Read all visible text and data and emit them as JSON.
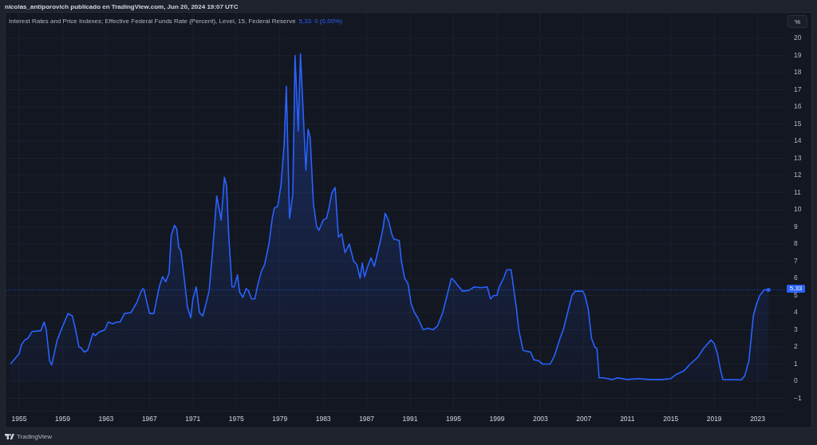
{
  "header": {
    "publication": "nicolas_antiporovich publicado en TradingView.com, Jun 20, 2024 19:07 UTC"
  },
  "chart": {
    "legend": {
      "title": "Interest Rates and Price Indexes; Effective Federal Funds Rate (Percent), Level, 15, Federal Reserve",
      "value": "5,33",
      "change": "0 (0,00%)"
    },
    "scale_button": "%",
    "chart_data": {
      "type": "area",
      "grid": true,
      "x": [
        1954.2,
        1954.6,
        1955.0,
        1955.2,
        1955.5,
        1955.8,
        1956.2,
        1957.0,
        1957.3,
        1957.5,
        1957.8,
        1958.0,
        1958.5,
        1959.0,
        1959.5,
        1959.9,
        1960.2,
        1960.5,
        1960.7,
        1961.0,
        1961.3,
        1961.8,
        1962.0,
        1962.3,
        1962.9,
        1963.2,
        1963.6,
        1964.0,
        1964.3,
        1964.7,
        1965.3,
        1965.8,
        1966.2,
        1966.4,
        1966.5,
        1967.0,
        1967.4,
        1967.9,
        1968.2,
        1968.5,
        1968.8,
        1969.0,
        1969.3,
        1969.5,
        1969.7,
        1969.9,
        1970.2,
        1970.5,
        1970.8,
        1971.0,
        1971.3,
        1971.6,
        1971.9,
        1972.2,
        1972.5,
        1972.8,
        1973.2,
        1973.6,
        1973.9,
        1974.1,
        1974.3,
        1974.6,
        1974.8,
        1975.1,
        1975.3,
        1975.6,
        1975.9,
        1976.1,
        1976.4,
        1976.7,
        1977.0,
        1977.3,
        1977.6,
        1978.0,
        1978.3,
        1978.5,
        1978.8,
        1979.1,
        1979.4,
        1979.6,
        1979.9,
        1980.2,
        1980.4,
        1980.7,
        1980.9,
        1981.4,
        1981.6,
        1981.8,
        1982.1,
        1982.4,
        1982.6,
        1983.0,
        1983.3,
        1983.5,
        1983.8,
        1984.1,
        1984.4,
        1984.7,
        1985.0,
        1985.4,
        1985.8,
        1986.1,
        1986.4,
        1986.6,
        1986.8,
        1987.1,
        1987.4,
        1987.7,
        1988.0,
        1988.2,
        1988.5,
        1988.7,
        1989.0,
        1989.3,
        1989.5,
        1990.0,
        1990.2,
        1990.5,
        1990.8,
        1991.1,
        1991.4,
        1991.7,
        1992.2,
        1992.6,
        1993.1,
        1993.5,
        1994.0,
        1994.4,
        1994.8,
        1995.0,
        1995.5,
        1995.8,
        1996.4,
        1996.9,
        1997.5,
        1998.1,
        1998.4,
        1998.7,
        1999.0,
        1999.2,
        1999.6,
        1999.9,
        2000.3,
        2000.8,
        2001.0,
        2001.4,
        2001.7,
        2002.1,
        2002.4,
        2002.8,
        2003.2,
        2003.9,
        2004.3,
        2004.8,
        2005.1,
        2005.5,
        2005.7,
        2005.9,
        2006.2,
        2006.9,
        2007.1,
        2007.4,
        2007.7,
        2008.0,
        2008.2,
        2008.4,
        2008.8,
        2009.6,
        2010.1,
        2011.0,
        2012.0,
        2013.0,
        2014.2,
        2015.0,
        2015.5,
        2016.2,
        2016.8,
        2017.5,
        2018.0,
        2018.7,
        2019.0,
        2019.3,
        2019.6,
        2019.8,
        2021.5,
        2021.8,
        2022.2,
        2022.4,
        2022.6,
        2022.9,
        2023.2,
        2023.6,
        2024.0
      ],
      "values": [
        1.0,
        1.3,
        1.6,
        2.1,
        2.4,
        2.5,
        2.9,
        2.95,
        3.45,
        3.0,
        1.2,
        0.95,
        2.4,
        3.2,
        3.95,
        3.8,
        3.0,
        2.0,
        1.95,
        1.7,
        1.8,
        2.8,
        2.65,
        2.85,
        3.0,
        3.45,
        3.35,
        3.45,
        3.45,
        3.95,
        4.0,
        4.55,
        5.2,
        5.4,
        5.35,
        3.95,
        3.95,
        5.5,
        6.1,
        5.8,
        6.3,
        8.5,
        9.1,
        8.9,
        7.8,
        7.6,
        6.0,
        4.3,
        3.7,
        4.8,
        5.5,
        4.0,
        3.8,
        4.5,
        5.3,
        7.5,
        10.8,
        9.4,
        11.9,
        11.4,
        8.5,
        5.5,
        5.5,
        6.2,
        5.2,
        4.9,
        5.4,
        5.3,
        4.8,
        4.8,
        5.7,
        6.4,
        6.8,
        8.0,
        9.5,
        10.1,
        10.2,
        11.4,
        13.8,
        17.2,
        9.5,
        10.9,
        19.0,
        14.6,
        19.1,
        12.3,
        14.7,
        14.2,
        10.3,
        9.0,
        8.8,
        9.4,
        9.5,
        10.0,
        11.0,
        11.3,
        8.4,
        8.6,
        7.5,
        8.0,
        7.0,
        6.8,
        6.0,
        6.9,
        6.1,
        6.7,
        7.2,
        6.7,
        7.5,
        8.0,
        8.9,
        9.8,
        9.4,
        8.6,
        8.3,
        8.2,
        7.0,
        6.0,
        5.7,
        4.5,
        4.0,
        3.7,
        3.0,
        3.1,
        3.0,
        3.2,
        4.0,
        5.0,
        6.0,
        5.9,
        5.5,
        5.25,
        5.3,
        5.5,
        5.45,
        5.5,
        4.8,
        5.0,
        5.0,
        5.5,
        6.0,
        6.5,
        6.5,
        4.2,
        3.0,
        1.8,
        1.75,
        1.7,
        1.25,
        1.2,
        1.0,
        1.0,
        1.5,
        2.5,
        3.0,
        4.0,
        4.5,
        5.0,
        5.25,
        5.25,
        5.0,
        4.2,
        2.5,
        2.0,
        1.9,
        0.2,
        0.2,
        0.1,
        0.2,
        0.1,
        0.15,
        0.1,
        0.1,
        0.15,
        0.4,
        0.6,
        1.0,
        1.4,
        1.9,
        2.4,
        2.2,
        1.6,
        0.6,
        0.1,
        0.08,
        0.3,
        1.2,
        2.5,
        3.8,
        4.5,
        5.0,
        5.33,
        5.33
      ],
      "ref_lines": [
        {
          "axis": "y",
          "value": 5.33,
          "label": "5,33"
        }
      ],
      "xlim": [
        1953.75,
        2025.6
      ],
      "ylim": [
        -1.72,
        21.49
      ],
      "xticks": [
        1955,
        1959,
        1963,
        1967,
        1971,
        1975,
        1979,
        1983,
        1987,
        1991,
        1995,
        1999,
        2003,
        2007,
        2011,
        2015,
        2019,
        2023
      ],
      "yticks": [
        {
          "value": -1,
          "label": "−1"
        },
        0,
        1,
        2,
        3,
        4,
        5,
        6,
        7,
        8,
        9,
        10,
        11,
        12,
        13,
        14,
        15,
        16,
        17,
        18,
        19,
        20
      ]
    }
  },
  "footer": {
    "brand": "TradingView"
  }
}
